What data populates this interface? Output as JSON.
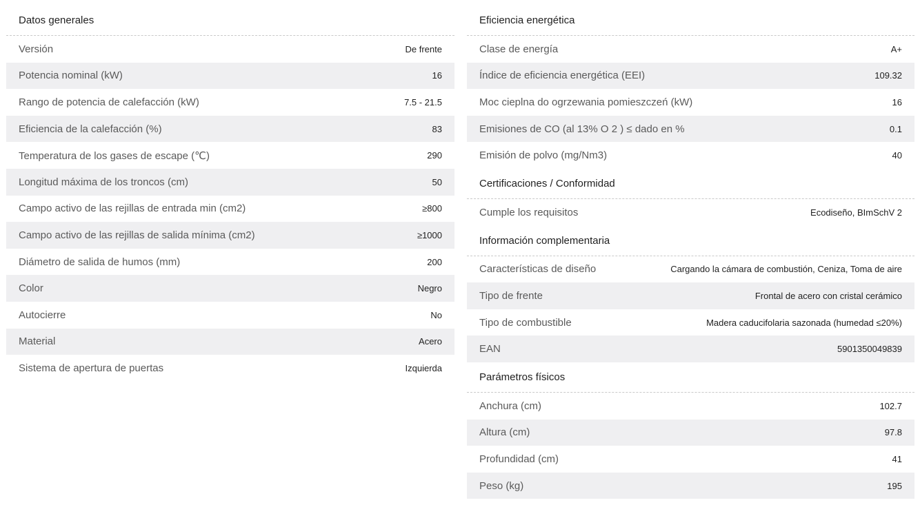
{
  "left": {
    "sections": [
      {
        "title": "Datos generales",
        "rows": [
          {
            "label": "Versión",
            "value": "De frente"
          },
          {
            "label": "Potencia nominal (kW)",
            "value": "16"
          },
          {
            "label": "Rango de potencia de calefacción (kW)",
            "value": "7.5 - 21.5"
          },
          {
            "label": "Eficiencia de la calefacción (%)",
            "value": "83"
          },
          {
            "label": "Temperatura de los gases de escape (℃)",
            "value": "290"
          },
          {
            "label": "Longitud máxima de los troncos (cm)",
            "value": "50"
          },
          {
            "label": "Campo activo de las rejillas de entrada min (cm2)",
            "value": "≥800"
          },
          {
            "label": "Campo activo de las rejillas de salida mínima (cm2)",
            "value": "≥1000"
          },
          {
            "label": "Diámetro de salida de humos (mm)",
            "value": "200"
          },
          {
            "label": "Color",
            "value": "Negro"
          },
          {
            "label": "Autocierre",
            "value": "No"
          },
          {
            "label": "Material",
            "value": "Acero"
          },
          {
            "label": "Sistema de apertura de puertas",
            "value": "Izquierda"
          }
        ]
      }
    ]
  },
  "right": {
    "sections": [
      {
        "title": "Eficiencia energética",
        "rows": [
          {
            "label": "Clase de energía",
            "value": "A+"
          },
          {
            "label": "Índice de eficiencia energética (EEI)",
            "value": "109.32"
          },
          {
            "label": "Moc cieplna do ogrzewania pomieszczeń (kW)",
            "value": "16"
          },
          {
            "label": "Emisiones de CO (al 13% O 2 ) ≤ dado en %",
            "value": "0.1"
          },
          {
            "label": "Emisión de polvo (mg/Nm3)",
            "value": "40"
          }
        ]
      },
      {
        "title": "Certificaciones / Conformidad",
        "rows": [
          {
            "label": "Cumple los requisitos",
            "value": "Ecodiseño, BImSchV 2"
          }
        ]
      },
      {
        "title": "Información complementaria",
        "rows": [
          {
            "label": "Características de diseño",
            "value": "Cargando la cámara de combustión, Ceniza, Toma de aire"
          },
          {
            "label": "Tipo de frente",
            "value": "Frontal de acero con cristal cerámico"
          },
          {
            "label": "Tipo de combustible",
            "value": "Madera caducifolaria sazonada (humedad ≤20%)"
          },
          {
            "label": "EAN",
            "value": "5901350049839"
          }
        ]
      },
      {
        "title": "Parámetros físicos",
        "rows": [
          {
            "label": "Anchura (cm)",
            "value": "102.7"
          },
          {
            "label": "Altura (cm)",
            "value": "97.8"
          },
          {
            "label": "Profundidad (cm)",
            "value": "41"
          },
          {
            "label": "Peso (kg)",
            "value": "195"
          }
        ]
      }
    ]
  }
}
